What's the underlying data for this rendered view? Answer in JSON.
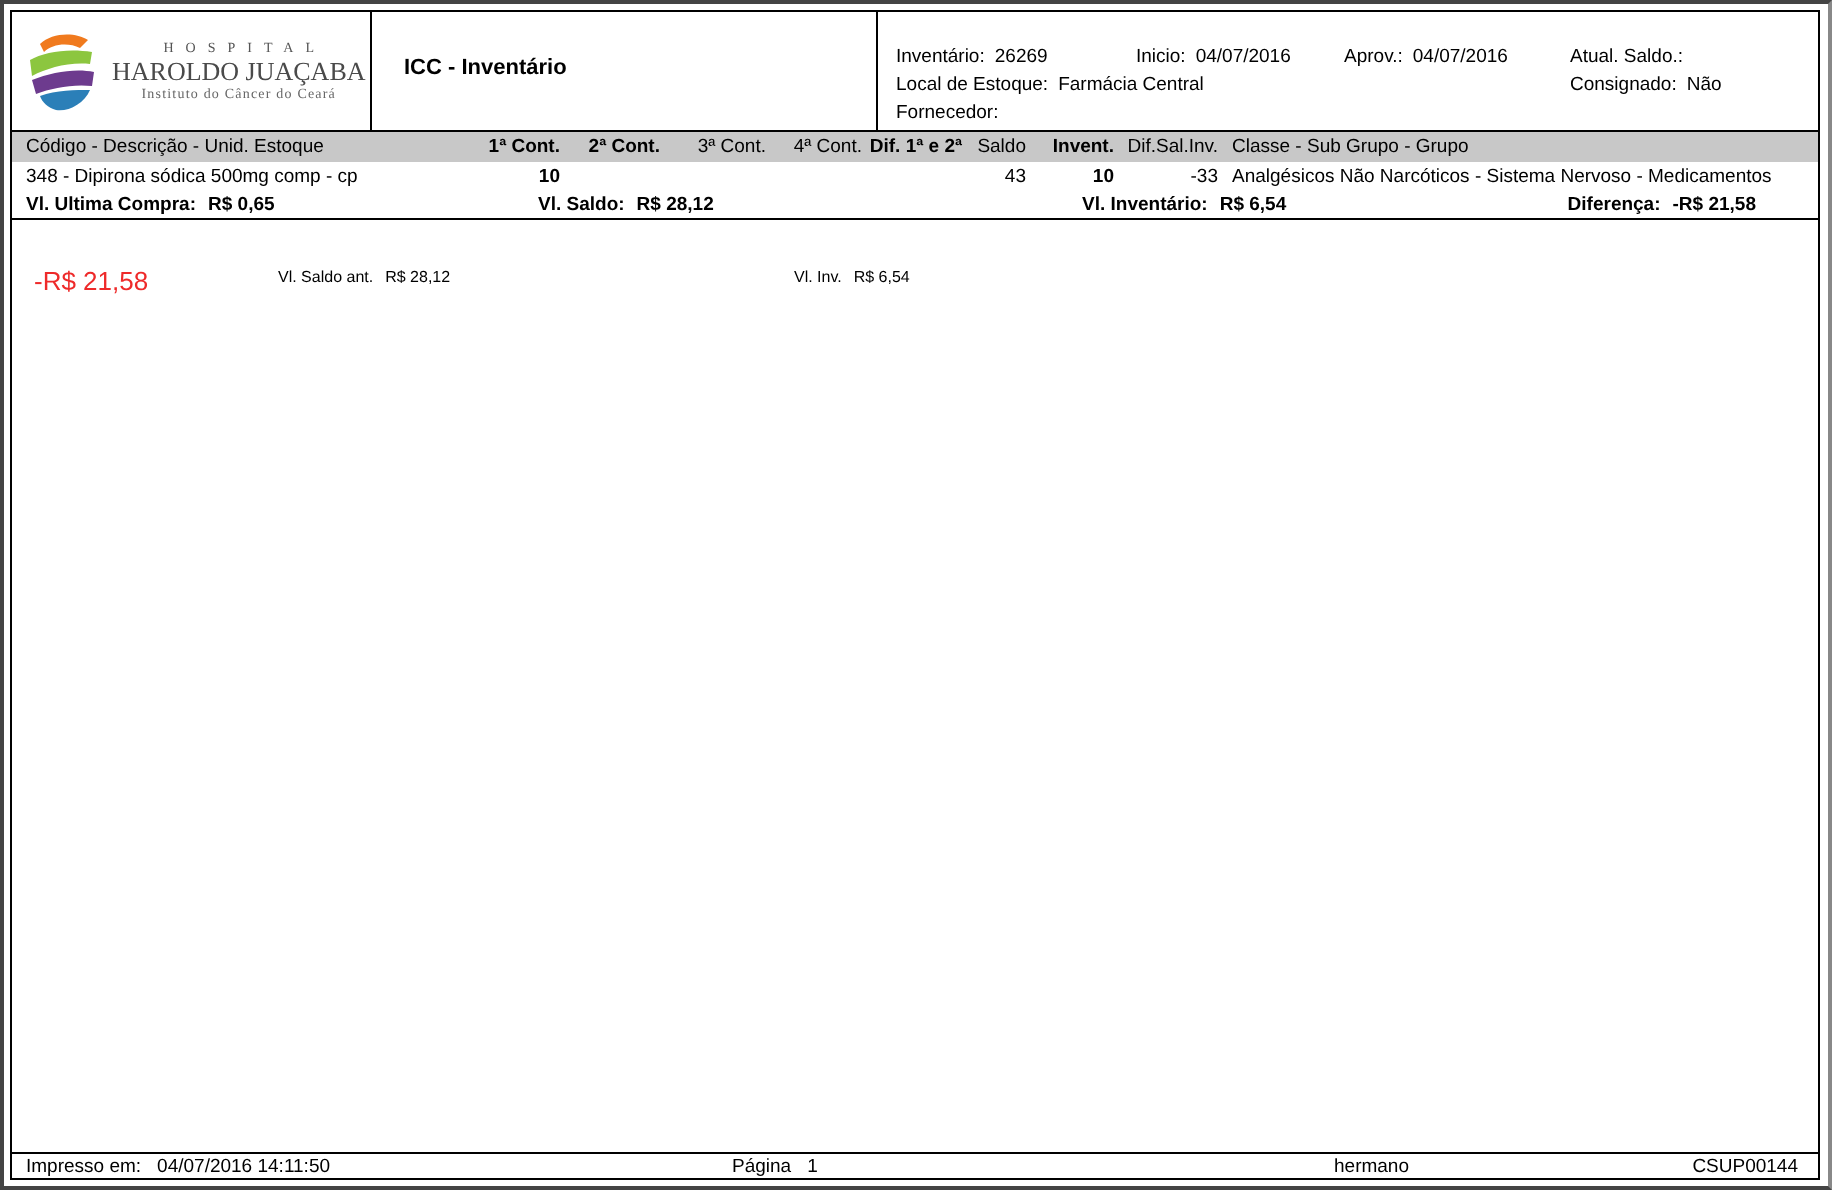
{
  "logo": {
    "kicker": "HOSPITAL",
    "name": "HAROLDO JUAÇABA",
    "tagline": "Instituto do Câncer do Ceará"
  },
  "report_title": "ICC - Inventário",
  "info": [
    [
      {
        "label": "Inventário:",
        "value": "26269"
      },
      {
        "label": "Inicio:",
        "value": "04/07/2016"
      },
      {
        "label": "Aprov.:",
        "value": "04/07/2016"
      },
      {
        "label": "Atual. Saldo.:"
      }
    ],
    [
      {
        "label": "Local de Estoque:",
        "value": "Farmácia Central"
      },
      {
        "label": "Consignado:",
        "value": "Não"
      }
    ],
    [
      {
        "label": "Fornecedor:"
      }
    ]
  ],
  "table": {
    "columns": [
      {
        "label": "Código - Descrição - Unid. Estoque",
        "bold": false,
        "row_value": "348 - Dipirona sódica 500mg comp - cp"
      },
      {
        "label": "1ª Cont.",
        "bold": true,
        "row_value": "10"
      },
      {
        "label": "2ª Cont.",
        "bold": true
      },
      {
        "label": "3ª Cont.",
        "bold": false
      },
      {
        "label": "4ª Cont.",
        "bold": false
      },
      {
        "label": "Dif. 1ª e 2ª",
        "bold": true
      },
      {
        "label": "Saldo",
        "bold": false,
        "row_value": "43"
      },
      {
        "label": "Invent.",
        "bold": true,
        "row_value": "10"
      },
      {
        "label": "Dif.Sal.Inv.",
        "bold": false,
        "row_value": "-33"
      },
      {
        "label": "Classe - Sub Grupo - Grupo",
        "bold": false,
        "row_value": "Analgésicos Não Narcóticos - Sistema Nervoso - Medicamentos"
      }
    ],
    "totals": [
      {
        "label": "Vl. Ultima Compra:",
        "value": "R$ 0,65"
      },
      {
        "label": "Vl. Saldo:",
        "value": "R$ 28,12"
      },
      {
        "label": "Vl. Inventário:",
        "value": "R$ 6,54"
      },
      {
        "label": "Diferença:",
        "value": "-R$ 21,58"
      }
    ]
  },
  "summary": {
    "difference": "-R$ 21,58",
    "items": [
      {
        "label": "Vl. Saldo ant.",
        "value": "R$ 28,12"
      },
      {
        "label": "Vl. Inv.",
        "value": "R$ 6,54"
      }
    ]
  },
  "footer": {
    "printed_label": "Impresso em:",
    "printed_at": "04/07/2016 14:11:50",
    "page_label": "Página",
    "page": "1",
    "user": "hermano",
    "code": "CSUP00144"
  }
}
